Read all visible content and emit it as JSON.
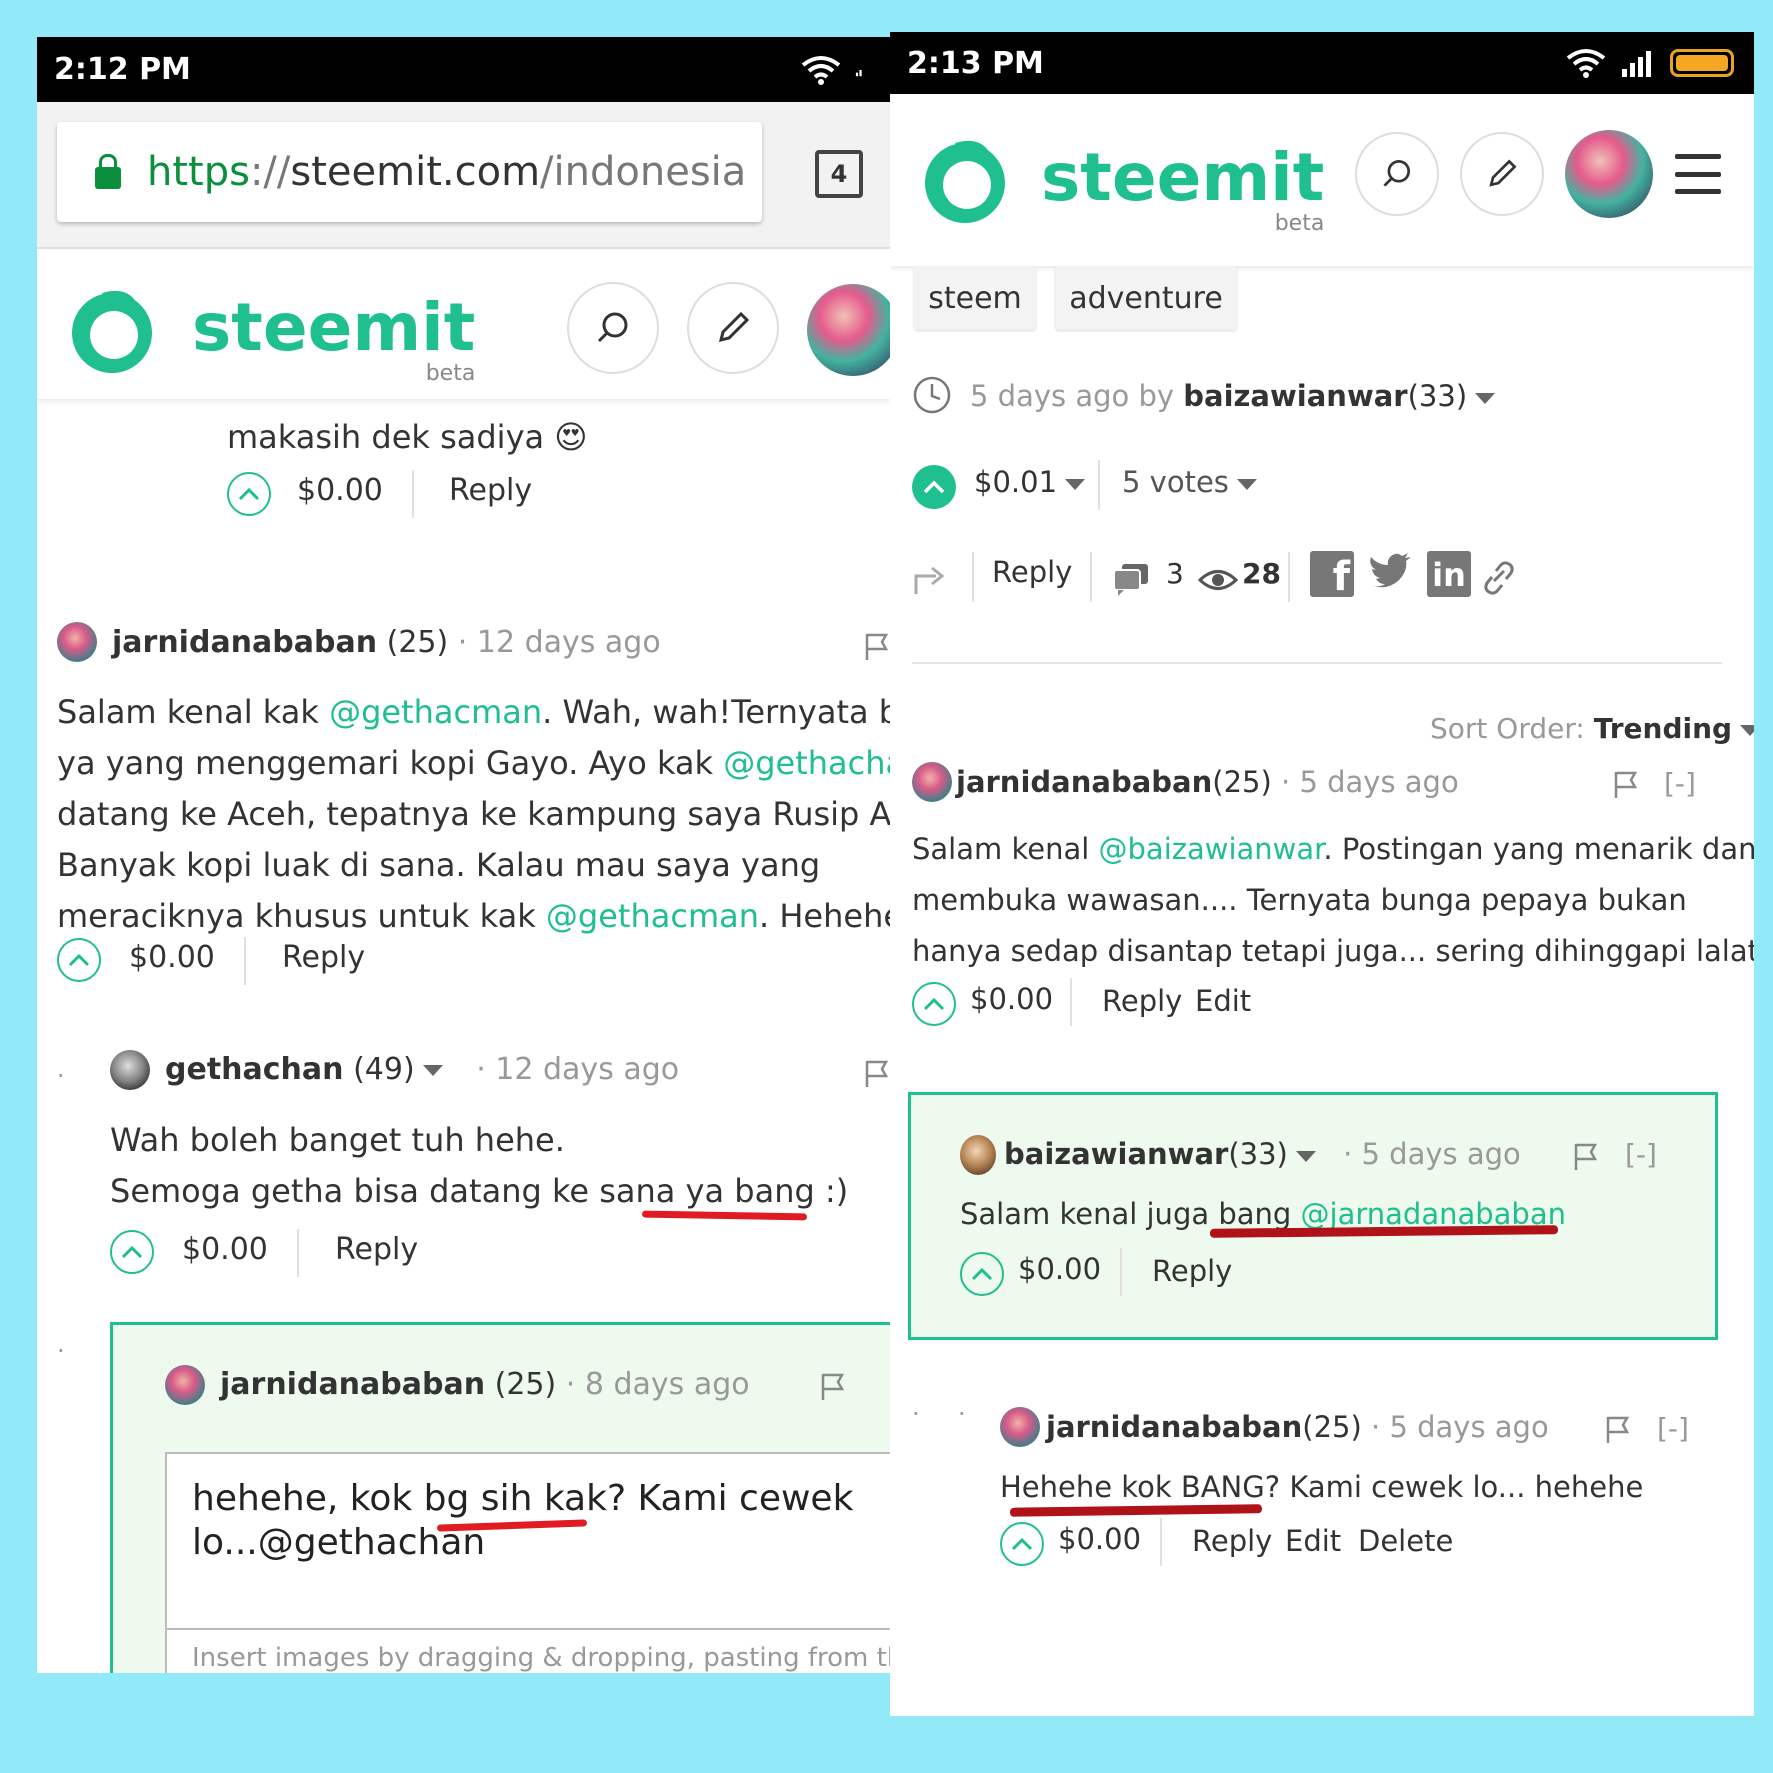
{
  "left": {
    "status_time": "2:12 PM",
    "url_scheme": "https",
    "url_sep": "://",
    "url_host": "steemit.com",
    "url_path": "/indonesia",
    "tab_count": "4",
    "logo_text": "steemit",
    "logo_beta": "beta",
    "c0": {
      "text": "makasih dek sadiya",
      "emoji": "😍",
      "amount": "$0.00",
      "reply": "Reply"
    },
    "c1": {
      "author": "jarnidanababan",
      "rep": "(25)",
      "dot": "·",
      "time": "12 days ago",
      "l1a": "Salam kenal kak ",
      "l1m": "@gethacman",
      "l1b": ". Wah, wah!Ternyata b",
      "l2a": "ya yang menggemari kopi Gayo. Ayo kak ",
      "l2m": "@gethachan",
      "l3": "datang ke Aceh, tepatnya ke kampung saya Rusip An",
      "l4": "Banyak kopi luak di sana. Kalau mau saya yang",
      "l5a": "meraciknya khusus untuk kak ",
      "l5m": "@gethacman",
      "l5b": ". Hehehe",
      "amount": "$0.00",
      "reply": "Reply"
    },
    "c2": {
      "author": "gethachan",
      "rep": "(49)",
      "dot": "·",
      "time": "12 days ago",
      "l1": "Wah boleh banget tuh hehe.",
      "l2": "Semoga getha bisa datang ke sana ya bang :)",
      "amount": "$0.00",
      "reply": "Reply"
    },
    "c3": {
      "author": "jarnidanababan",
      "rep": "(25)",
      "dot": "·",
      "time": "8 days ago",
      "editor_l1": "hehehe, kok bg sih kak? Kami cewek",
      "editor_l2": "lo...@gethachan",
      "hint": "Insert images by dragging & dropping, pasting from the"
    }
  },
  "right": {
    "status_time": "2:13 PM",
    "logo_text": "steemit",
    "logo_beta": "beta",
    "tags": [
      "steem",
      "adventure"
    ],
    "meta_time": "5 days ago by ",
    "meta_author": "baizawianwar",
    "meta_rep": "(33)",
    "payout": "$0.01",
    "votes": "5 votes",
    "reply": "Reply",
    "comments": "3",
    "views": "28",
    "sort_label": "Sort Order:",
    "sort_value": "Trending",
    "c1": {
      "author": "jarnidanababan",
      "rep": "(25)",
      "dot": "·",
      "time": "5 days ago",
      "collapse": "[-]",
      "l1a": "Salam kenal ",
      "l1m": "@baizawianwar",
      "l1b": ". Postingan yang menarik dan",
      "l2": "membuka wawasan.... Ternyata bunga pepaya bukan",
      "l3": "hanya sedap disantap tetapi juga... sering dihinggapi lalat.",
      "amount": "$0.00",
      "reply": "Reply",
      "edit": "Edit"
    },
    "c2": {
      "author": "baizawianwar",
      "rep": "(33)",
      "dot": "·",
      "time": "5 days ago",
      "collapse": "[-]",
      "la": "Salam kenal juga bang ",
      "lm": "@jarnadanababan",
      "amount": "$0.00",
      "reply": "Reply"
    },
    "c3": {
      "author": "jarnidanababan",
      "rep": "(25)",
      "dot": "·",
      "time": "5 days ago",
      "collapse": "[-]",
      "l1": "Hehehe kok BANG? Kami cewek lo... hehehe",
      "amount": "$0.00",
      "reply": "Reply",
      "edit": "Edit",
      "delete": "Delete"
    }
  }
}
